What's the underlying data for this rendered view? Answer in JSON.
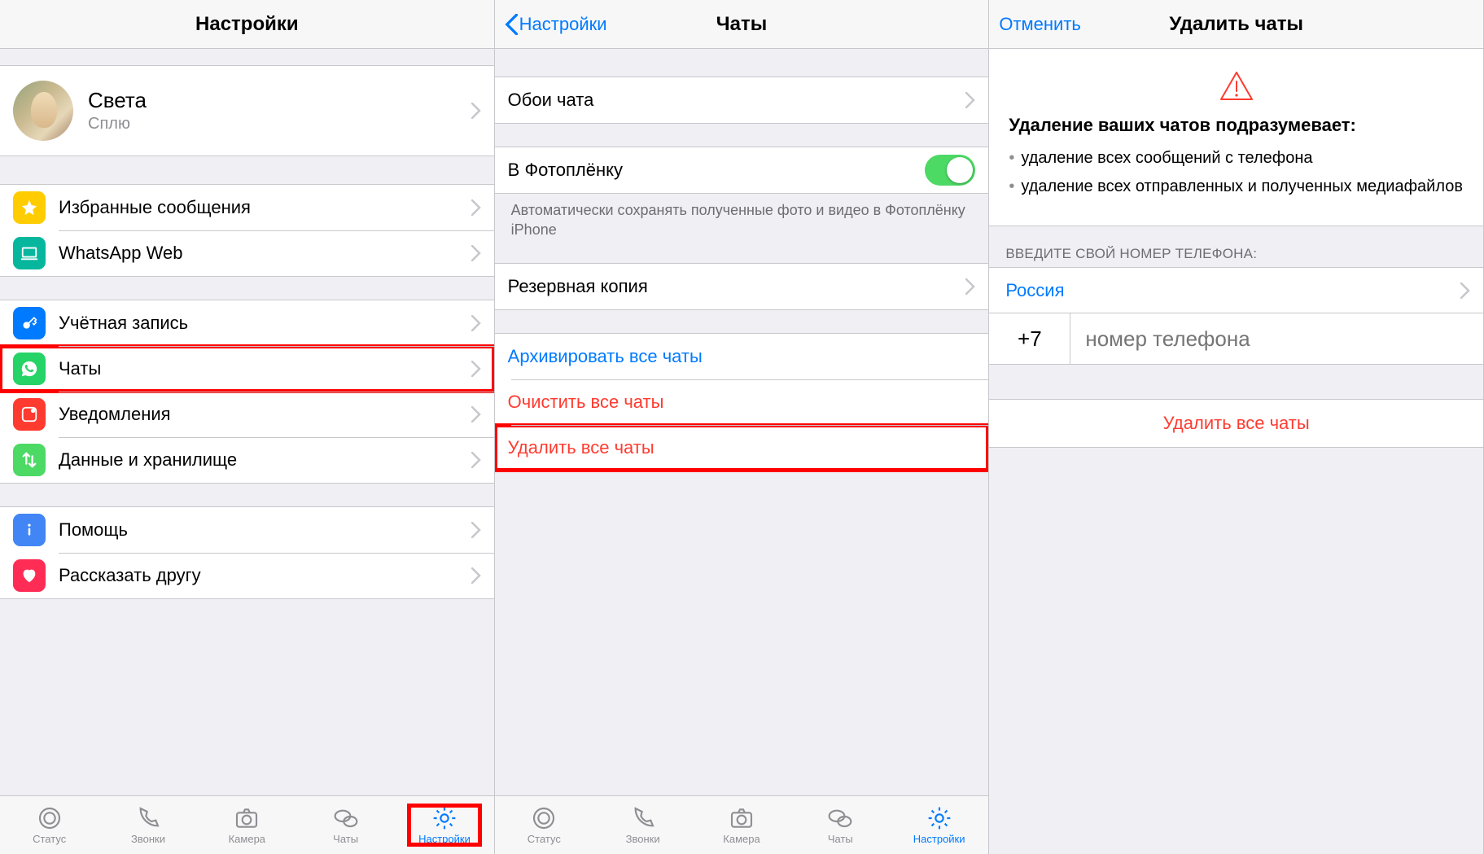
{
  "panel1": {
    "title": "Настройки",
    "profile": {
      "name": "Света",
      "status": "Сплю"
    },
    "groupA": {
      "starred": "Избранные сообщения",
      "web": "WhatsApp Web"
    },
    "groupB": {
      "account": "Учётная запись",
      "chats": "Чаты",
      "notifications": "Уведомления",
      "storage": "Данные и хранилище"
    },
    "groupC": {
      "help": "Помощь",
      "tell": "Рассказать другу"
    }
  },
  "panel2": {
    "back": "Настройки",
    "title": "Чаты",
    "wallpaper": "Обои чата",
    "cameraRoll": "В Фотоплёнку",
    "cameraRollNote": "Автоматически сохранять полученные фото и видео в Фотоплёнку iPhone",
    "backup": "Резервная копия",
    "archive": "Архивировать все чаты",
    "clear": "Очистить все чаты",
    "deleteAll": "Удалить все чаты"
  },
  "panel3": {
    "cancel": "Отменить",
    "title": "Удалить чаты",
    "heading": "Удаление ваших чатов подразумевает:",
    "bullet1": "удаление всех сообщений с телефона",
    "bullet2": "удаление всех отправленных и полученных медиафайлов",
    "enterPhoneHeader": "ВВЕДИТЕ СВОЙ НОМЕР ТЕЛЕФОНА:",
    "country": "Россия",
    "dialCode": "+7",
    "phonePlaceholder": "номер телефона",
    "deleteBtn": "Удалить все чаты"
  },
  "tabs": {
    "status": "Статус",
    "calls": "Звонки",
    "camera": "Камера",
    "chats": "Чаты",
    "settings": "Настройки"
  }
}
